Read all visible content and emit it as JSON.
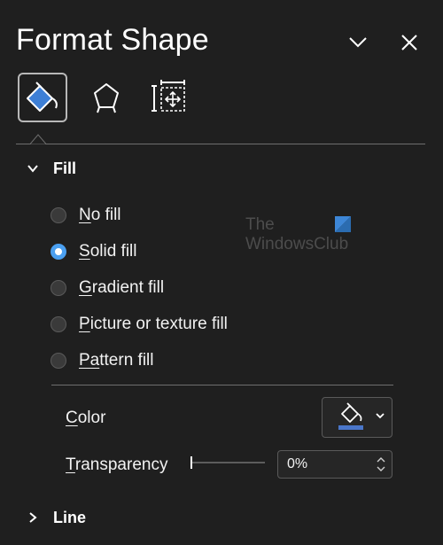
{
  "pane": {
    "title": "Format Shape",
    "collapse_icon": "chevron-down-icon",
    "close_icon": "close-icon"
  },
  "tabs": [
    {
      "name": "fill-line",
      "icon": "paint-bucket-icon",
      "active": true
    },
    {
      "name": "effects",
      "icon": "pentagon-icon",
      "active": false
    },
    {
      "name": "size-properties",
      "icon": "size-properties-icon",
      "active": false
    }
  ],
  "fill_section": {
    "title": "Fill",
    "expanded": true,
    "options": [
      {
        "key": "N",
        "rest": "o fill",
        "selected": false
      },
      {
        "key": "S",
        "rest": "olid fill",
        "selected": true
      },
      {
        "key": "G",
        "rest": "radient fill",
        "selected": false
      },
      {
        "key": "P",
        "rest": "icture or texture fill",
        "selected": false
      },
      {
        "key": "Pa",
        "rest": "ttern fill",
        "selected": false
      }
    ],
    "color": {
      "key": "C",
      "rest": "olor",
      "swatch": "#4a76c9",
      "icon": "paint-bucket-icon"
    },
    "transparency": {
      "key": "T",
      "rest": "ransparency",
      "value": "0%",
      "level": 0
    }
  },
  "line_section": {
    "title": "Line",
    "expanded": false
  },
  "watermark": {
    "line1": "The",
    "line2": "WindowsClub"
  },
  "colors": {
    "accent": "#4a9ff0",
    "background": "#1f1f1f",
    "brand_blue": "#2b6cb0"
  }
}
